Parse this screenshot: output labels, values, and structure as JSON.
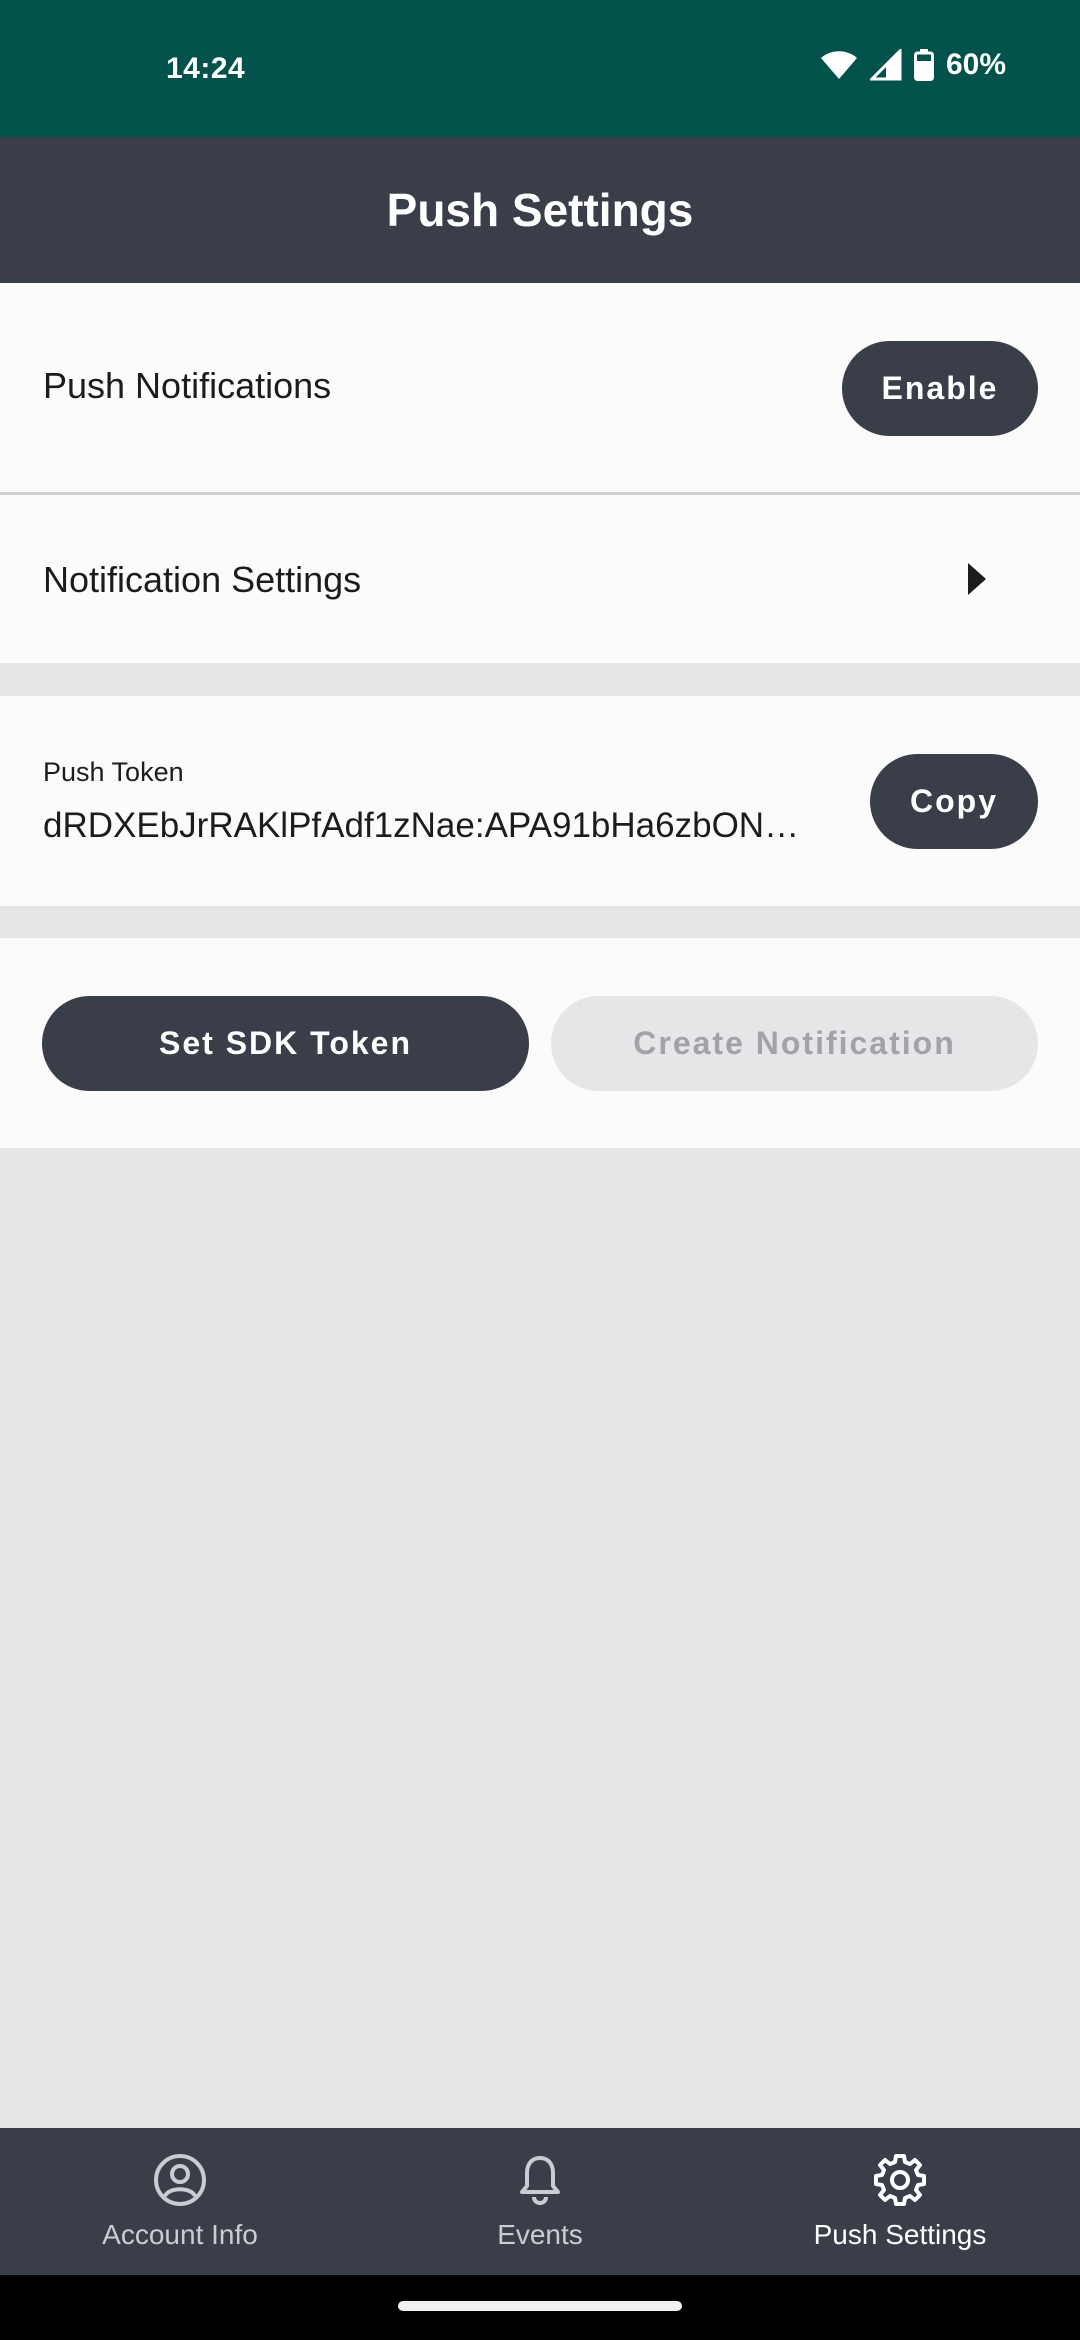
{
  "status_bar": {
    "time": "14:24",
    "battery": "60%"
  },
  "app_bar": {
    "title": "Push Settings"
  },
  "push_notifications": {
    "label": "Push Notifications",
    "button": "Enable"
  },
  "notification_settings": {
    "label": "Notification Settings"
  },
  "push_token": {
    "label": "Push Token",
    "value": "dRDXEbJrRAKlPfAdf1zNae:APA91bHa6zbON…",
    "copy_button": "Copy"
  },
  "actions": {
    "set_sdk_token": "Set SDK Token",
    "create_notification": "Create Notification"
  },
  "bottom_nav": {
    "items": [
      {
        "label": "Account Info",
        "icon": "account-circle-icon",
        "active": false
      },
      {
        "label": "Events",
        "icon": "bell-icon",
        "active": false
      },
      {
        "label": "Push Settings",
        "icon": "gear-icon",
        "active": true
      }
    ]
  },
  "colors": {
    "status_bar": "#00524a",
    "app_bar": "#393e48",
    "button": "#393e48",
    "disabled_button": "#e6e5e8",
    "background": "#e6e5e8"
  }
}
